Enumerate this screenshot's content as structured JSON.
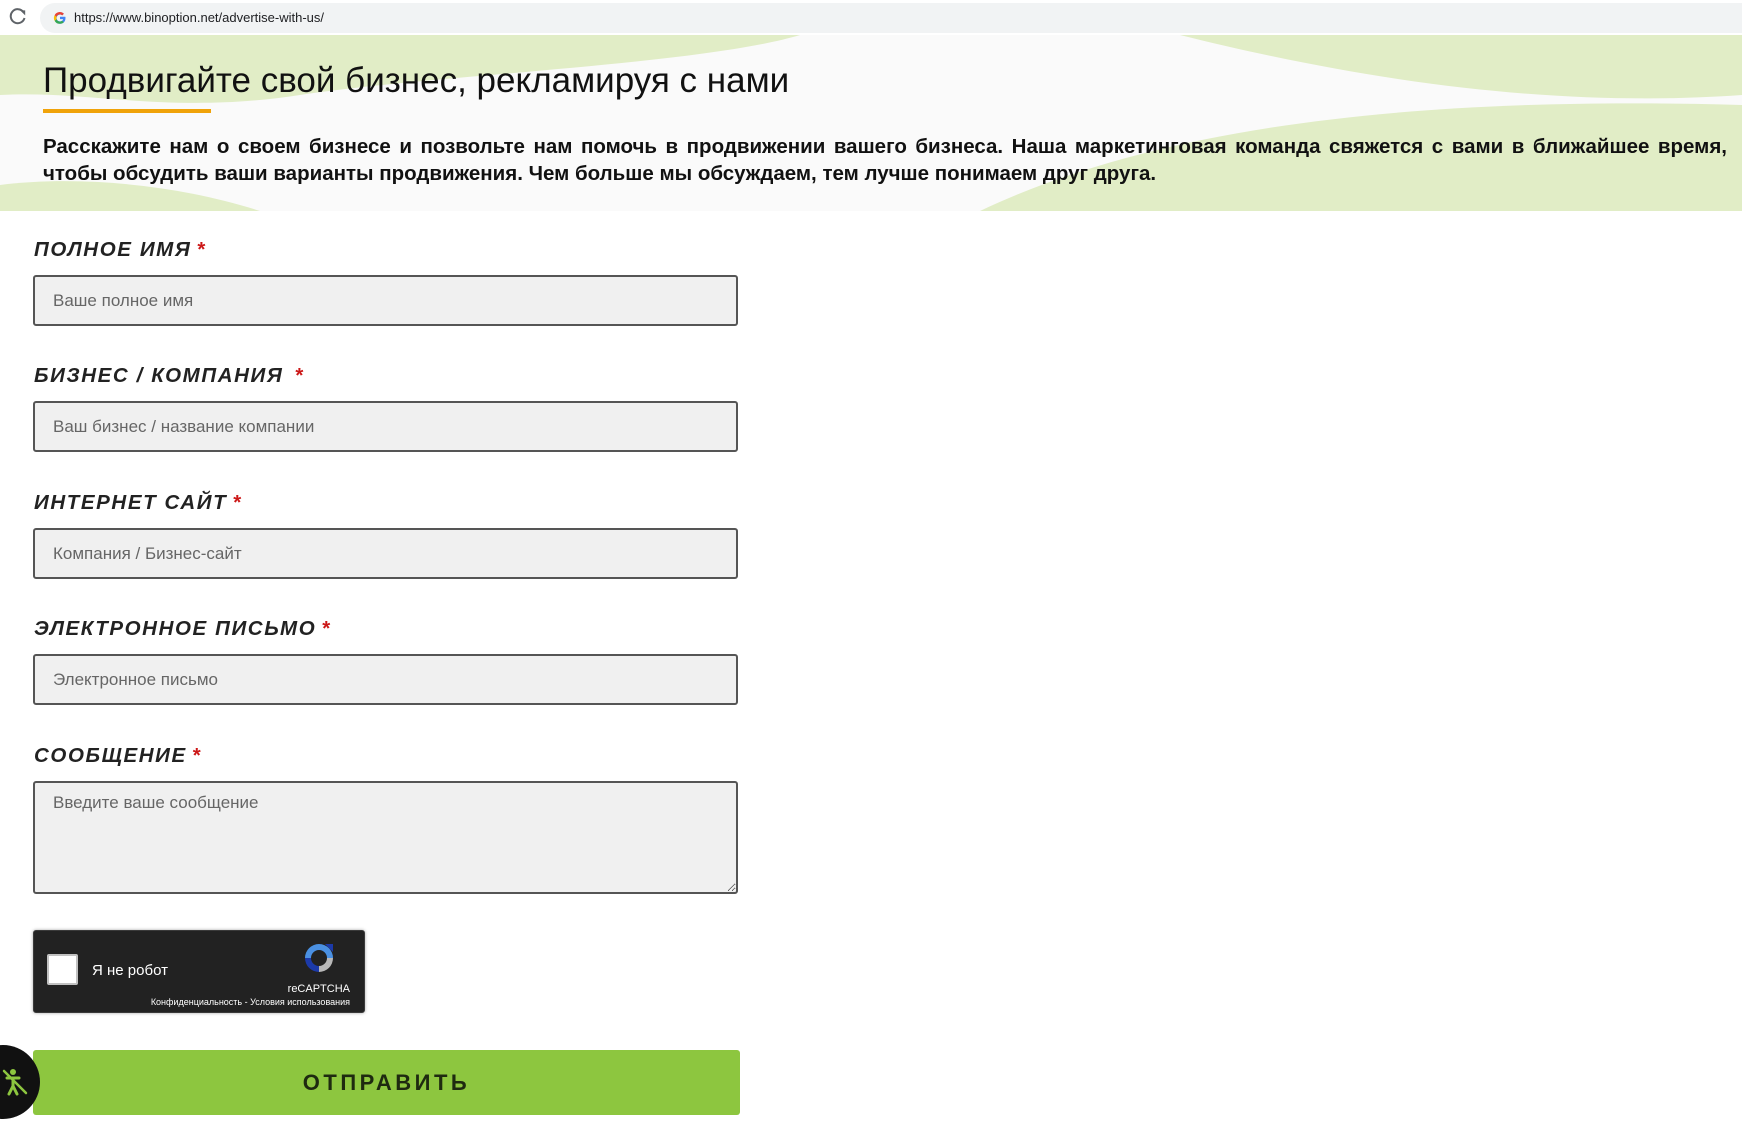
{
  "browser": {
    "url": "https://www.binoption.net/advertise-with-us/"
  },
  "hero": {
    "title": "Продвигайте свой бизнес, рекламируя с нами",
    "description": "Расскажите нам о своем бизнесе и позвольте нам помочь в продвижении вашего бизнеса. Наша маркетинговая команда свяжется с вами в ближайшее время, чтобы обсудить ваши варианты продвижения. Чем больше мы обсуждаем, тем лучше понимаем друг друга.",
    "background_color": "#e1edc6",
    "underline_color": "#f0a30a"
  },
  "form": {
    "required_mark": "*",
    "full_name": {
      "label": "ПОЛНОЕ ИМЯ",
      "value": "",
      "placeholder": "Ваше полное имя"
    },
    "company": {
      "label": "БИЗНЕС / КОМПАНИЯ",
      "value": "",
      "placeholder": "Ваш бизнес / название компании"
    },
    "website": {
      "label": "ИНТЕРНЕТ САЙТ",
      "value": "",
      "placeholder": "Компания / Бизнес-сайт"
    },
    "email": {
      "label": "ЭЛЕКТРОННОЕ ПИСЬМО",
      "value": "",
      "placeholder": "Электронное письмо"
    },
    "message": {
      "label": "СООБЩЕНИЕ",
      "value": "",
      "placeholder": "Введите ваше сообщение"
    },
    "recaptcha": {
      "checkbox_label": "Я не робот",
      "checked": false,
      "brand": "reCAPTCHA",
      "links": "Конфиденциальность - Условия использования"
    },
    "submit_label": "ОТПРАВИТЬ",
    "submit_color": "#8dc63f"
  },
  "icons": {
    "reload": "reload-icon",
    "google": "google-g-icon",
    "recaptcha": "recaptcha-logo-icon",
    "floating": "accessibility-icon"
  }
}
